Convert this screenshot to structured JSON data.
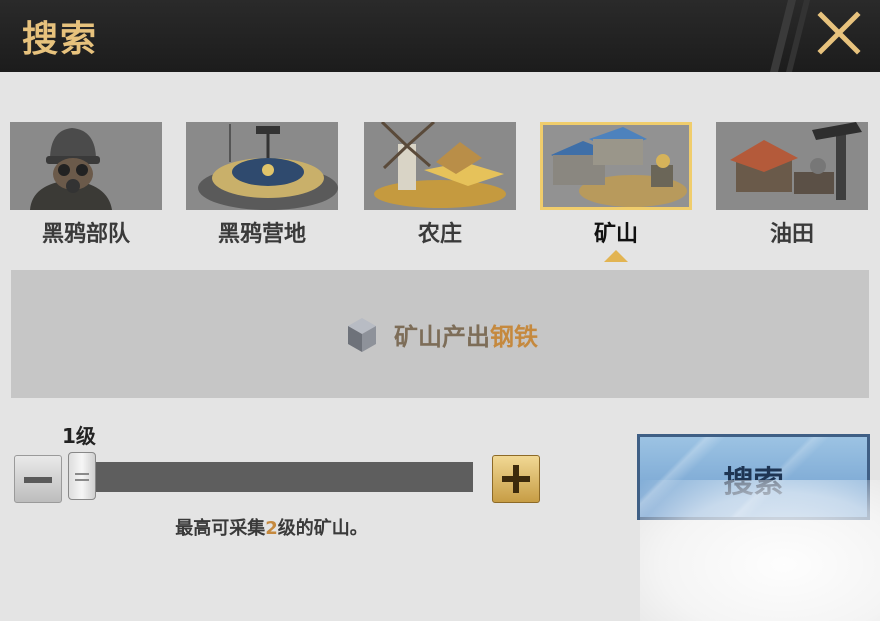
{
  "header": {
    "title": "搜索"
  },
  "tabs": [
    {
      "label": "黑鸦部队",
      "icon": "soldier-gasmask-icon",
      "active": false
    },
    {
      "label": "黑鸦营地",
      "icon": "camp-base-icon",
      "active": false
    },
    {
      "label": "农庄",
      "icon": "farm-windmill-icon",
      "active": false
    },
    {
      "label": "矿山",
      "icon": "mine-icon",
      "active": true
    },
    {
      "label": "油田",
      "icon": "oilfield-icon",
      "active": false
    }
  ],
  "info": {
    "part1": "矿山产出",
    "part2": "钢铁",
    "icon": "steel-ingot-icon"
  },
  "slider": {
    "level_label": "1级",
    "value": 1,
    "max": 2
  },
  "hint": {
    "part1": "最高可采集",
    "part2": "2",
    "part3": "级的矿山。"
  },
  "search_button": {
    "label": "搜索"
  },
  "colors": {
    "header_bg": "#222222",
    "title_gold": "#e7c27d",
    "active_border": "#f0cd6c",
    "highlight": "#c5893e",
    "search_blue": "#7fa9d6"
  }
}
